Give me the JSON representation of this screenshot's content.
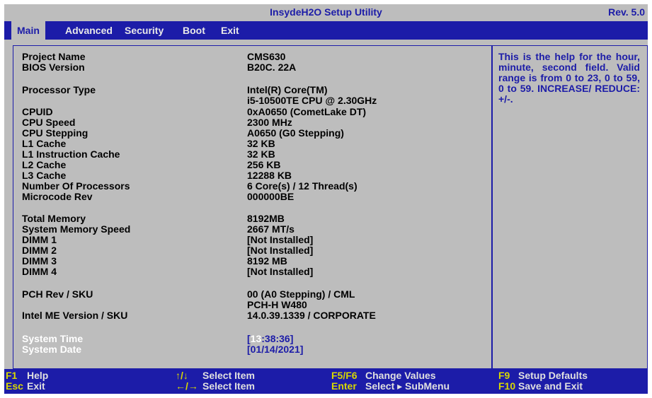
{
  "title": "InsydeH2O Setup Utility",
  "revision": "Rev. 5.0",
  "menu": [
    "Main",
    "Advanced",
    "Security",
    "Boot",
    "Exit"
  ],
  "info": {
    "project_name": {
      "label": "Project Name",
      "value": "CMS630"
    },
    "bios_version": {
      "label": "BIOS Version",
      "value": "B20C. 22A"
    },
    "processor_type": {
      "label": "Processor Type",
      "value_line1": "Intel(R) Core(TM)",
      "value_line2": "i5-10500TE CPU @ 2.30GHz"
    },
    "cpuid": {
      "label": "CPUID",
      "value": "0xA0650 (CometLake DT)"
    },
    "cpu_speed": {
      "label": "CPU Speed",
      "value": "2300 MHz"
    },
    "cpu_stepping": {
      "label": "CPU Stepping",
      "value": "A0650 (G0 Stepping)"
    },
    "l1_cache": {
      "label": "L1 Cache",
      "value": "32 KB"
    },
    "l1_instruction_cache": {
      "label": "L1 Instruction Cache",
      "value": "32 KB"
    },
    "l2_cache": {
      "label": "L2 Cache",
      "value": "256 KB"
    },
    "l3_cache": {
      "label": "L3 Cache",
      "value": "12288 KB"
    },
    "num_processors": {
      "label": "Number Of Processors",
      "value": "6 Core(s) / 12 Thread(s)"
    },
    "microcode_rev": {
      "label": "Microcode Rev",
      "value": "000000BE"
    },
    "total_memory": {
      "label": "Total Memory",
      "value": "8192MB"
    },
    "system_memory_speed": {
      "label": "System Memory Speed",
      "value": "2667 MT/s"
    },
    "dimm1": {
      "label": "DIMM 1",
      "value": "[Not Installed]"
    },
    "dimm2": {
      "label": "DIMM 2",
      "value": "[Not Installed]"
    },
    "dimm3": {
      "label": "DIMM 3",
      "value": "8192 MB"
    },
    "dimm4": {
      "label": "DIMM 4",
      "value": "[Not Installed]"
    },
    "pch_rev": {
      "label": "PCH Rev / SKU",
      "value_line1": "00 (A0 Stepping) / CML",
      "value_line2": "PCH-H W480"
    },
    "intel_me": {
      "label": "Intel ME Version / SKU",
      "value": "14.0.39.1339 / CORPORATE"
    }
  },
  "system_time": {
    "label": "System Time",
    "bracket_open": "[",
    "hour": "13",
    "rest": ":38:36]"
  },
  "system_date": {
    "label": "System Date",
    "value": "[01/14/2021]"
  },
  "help": "This is the help for the hour, minute, second field. Valid range is from 0 to 23, 0 to 59, 0 to 59. INCREASE/ REDUCE: +/-.",
  "footer": {
    "f1_key": "F1",
    "f1_desc": "Help",
    "esc_key": "Esc",
    "esc_desc": "Exit",
    "updown_key": "↑/↓",
    "updown_desc": "Select Item",
    "leftright_key": "←/→",
    "leftright_desc": "Select Item",
    "f5f6_key": "F5/F6",
    "f5f6_desc": "Change Values",
    "enter_key": "Enter",
    "enter_desc": "Select ▸ SubMenu",
    "f9_key": "F9",
    "f9_desc": "Setup Defaults",
    "f10_key": "F10",
    "f10_desc": "Save and Exit"
  },
  "colors": {
    "background": "#bdbdbd",
    "accent_blue": "#1c1ca8",
    "footer_key": "#d8d800"
  }
}
